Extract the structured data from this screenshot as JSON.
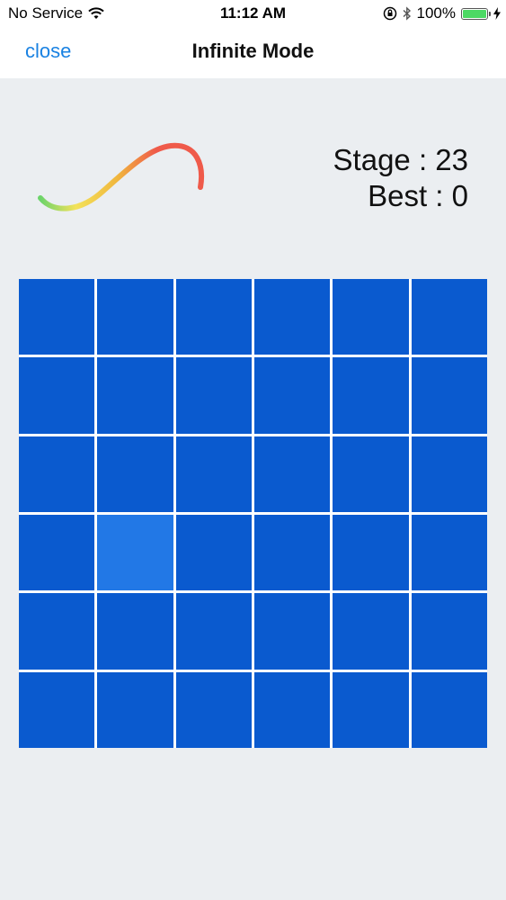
{
  "status_bar": {
    "carrier": "No Service",
    "time": "11:12 AM",
    "battery_percent": "100%"
  },
  "nav": {
    "close_label": "close",
    "title": "Infinite Mode"
  },
  "score": {
    "stage_label": "Stage : 23",
    "best_label": "Best : 0"
  },
  "grid": {
    "rows": 6,
    "columns": 6,
    "odd_cell": {
      "row": 4,
      "column": 2
    },
    "cell_color": "#0a5acf",
    "odd_cell_color": "#2278e6"
  },
  "timer": {
    "colors": [
      "#6cd46a",
      "#f3e25a",
      "#f0b63e",
      "#ef5a4a"
    ]
  }
}
